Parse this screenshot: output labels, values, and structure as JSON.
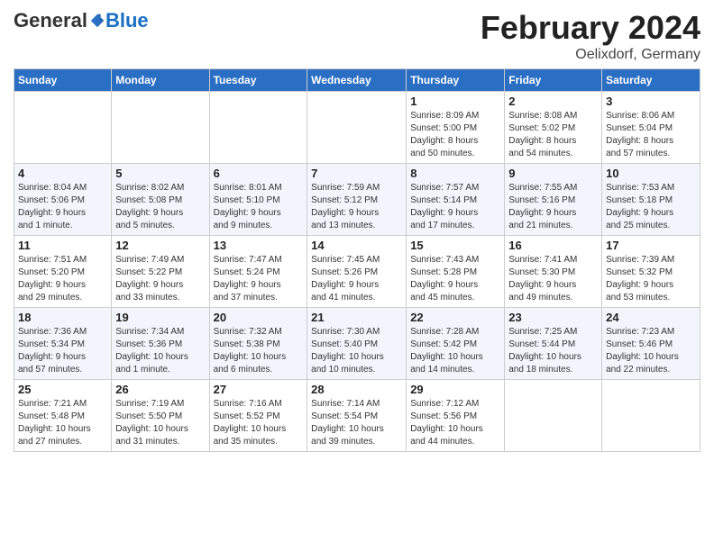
{
  "header": {
    "logo_general": "General",
    "logo_blue": "Blue",
    "month": "February 2024",
    "location": "Oelixdorf, Germany"
  },
  "weekdays": [
    "Sunday",
    "Monday",
    "Tuesday",
    "Wednesday",
    "Thursday",
    "Friday",
    "Saturday"
  ],
  "weeks": [
    [
      {
        "day": "",
        "info": ""
      },
      {
        "day": "",
        "info": ""
      },
      {
        "day": "",
        "info": ""
      },
      {
        "day": "",
        "info": ""
      },
      {
        "day": "1",
        "info": "Sunrise: 8:09 AM\nSunset: 5:00 PM\nDaylight: 8 hours\nand 50 minutes."
      },
      {
        "day": "2",
        "info": "Sunrise: 8:08 AM\nSunset: 5:02 PM\nDaylight: 8 hours\nand 54 minutes."
      },
      {
        "day": "3",
        "info": "Sunrise: 8:06 AM\nSunset: 5:04 PM\nDaylight: 8 hours\nand 57 minutes."
      }
    ],
    [
      {
        "day": "4",
        "info": "Sunrise: 8:04 AM\nSunset: 5:06 PM\nDaylight: 9 hours\nand 1 minute."
      },
      {
        "day": "5",
        "info": "Sunrise: 8:02 AM\nSunset: 5:08 PM\nDaylight: 9 hours\nand 5 minutes."
      },
      {
        "day": "6",
        "info": "Sunrise: 8:01 AM\nSunset: 5:10 PM\nDaylight: 9 hours\nand 9 minutes."
      },
      {
        "day": "7",
        "info": "Sunrise: 7:59 AM\nSunset: 5:12 PM\nDaylight: 9 hours\nand 13 minutes."
      },
      {
        "day": "8",
        "info": "Sunrise: 7:57 AM\nSunset: 5:14 PM\nDaylight: 9 hours\nand 17 minutes."
      },
      {
        "day": "9",
        "info": "Sunrise: 7:55 AM\nSunset: 5:16 PM\nDaylight: 9 hours\nand 21 minutes."
      },
      {
        "day": "10",
        "info": "Sunrise: 7:53 AM\nSunset: 5:18 PM\nDaylight: 9 hours\nand 25 minutes."
      }
    ],
    [
      {
        "day": "11",
        "info": "Sunrise: 7:51 AM\nSunset: 5:20 PM\nDaylight: 9 hours\nand 29 minutes."
      },
      {
        "day": "12",
        "info": "Sunrise: 7:49 AM\nSunset: 5:22 PM\nDaylight: 9 hours\nand 33 minutes."
      },
      {
        "day": "13",
        "info": "Sunrise: 7:47 AM\nSunset: 5:24 PM\nDaylight: 9 hours\nand 37 minutes."
      },
      {
        "day": "14",
        "info": "Sunrise: 7:45 AM\nSunset: 5:26 PM\nDaylight: 9 hours\nand 41 minutes."
      },
      {
        "day": "15",
        "info": "Sunrise: 7:43 AM\nSunset: 5:28 PM\nDaylight: 9 hours\nand 45 minutes."
      },
      {
        "day": "16",
        "info": "Sunrise: 7:41 AM\nSunset: 5:30 PM\nDaylight: 9 hours\nand 49 minutes."
      },
      {
        "day": "17",
        "info": "Sunrise: 7:39 AM\nSunset: 5:32 PM\nDaylight: 9 hours\nand 53 minutes."
      }
    ],
    [
      {
        "day": "18",
        "info": "Sunrise: 7:36 AM\nSunset: 5:34 PM\nDaylight: 9 hours\nand 57 minutes."
      },
      {
        "day": "19",
        "info": "Sunrise: 7:34 AM\nSunset: 5:36 PM\nDaylight: 10 hours\nand 1 minute."
      },
      {
        "day": "20",
        "info": "Sunrise: 7:32 AM\nSunset: 5:38 PM\nDaylight: 10 hours\nand 6 minutes."
      },
      {
        "day": "21",
        "info": "Sunrise: 7:30 AM\nSunset: 5:40 PM\nDaylight: 10 hours\nand 10 minutes."
      },
      {
        "day": "22",
        "info": "Sunrise: 7:28 AM\nSunset: 5:42 PM\nDaylight: 10 hours\nand 14 minutes."
      },
      {
        "day": "23",
        "info": "Sunrise: 7:25 AM\nSunset: 5:44 PM\nDaylight: 10 hours\nand 18 minutes."
      },
      {
        "day": "24",
        "info": "Sunrise: 7:23 AM\nSunset: 5:46 PM\nDaylight: 10 hours\nand 22 minutes."
      }
    ],
    [
      {
        "day": "25",
        "info": "Sunrise: 7:21 AM\nSunset: 5:48 PM\nDaylight: 10 hours\nand 27 minutes."
      },
      {
        "day": "26",
        "info": "Sunrise: 7:19 AM\nSunset: 5:50 PM\nDaylight: 10 hours\nand 31 minutes."
      },
      {
        "day": "27",
        "info": "Sunrise: 7:16 AM\nSunset: 5:52 PM\nDaylight: 10 hours\nand 35 minutes."
      },
      {
        "day": "28",
        "info": "Sunrise: 7:14 AM\nSunset: 5:54 PM\nDaylight: 10 hours\nand 39 minutes."
      },
      {
        "day": "29",
        "info": "Sunrise: 7:12 AM\nSunset: 5:56 PM\nDaylight: 10 hours\nand 44 minutes."
      },
      {
        "day": "",
        "info": ""
      },
      {
        "day": "",
        "info": ""
      }
    ]
  ]
}
